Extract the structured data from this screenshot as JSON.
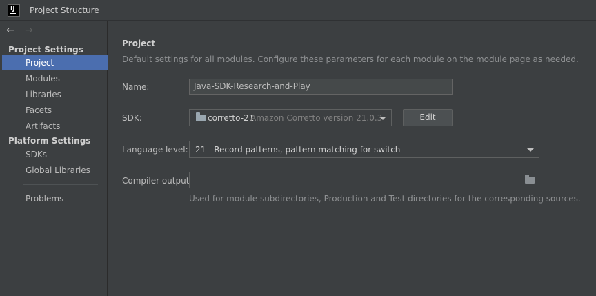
{
  "window": {
    "title": "Project Structure",
    "app_icon_text": "IJ"
  },
  "sidebar": {
    "section_project_settings": "Project Settings",
    "project_items": [
      {
        "label": "Project",
        "selected": true
      },
      {
        "label": "Modules"
      },
      {
        "label": "Libraries"
      },
      {
        "label": "Facets"
      },
      {
        "label": "Artifacts"
      }
    ],
    "section_platform_settings": "Platform Settings",
    "platform_items": [
      {
        "label": "SDKs"
      },
      {
        "label": "Global Libraries"
      }
    ],
    "problems": {
      "label": "Problems"
    }
  },
  "main": {
    "heading": "Project",
    "description": "Default settings for all modules. Configure these parameters for each module on the module page as needed.",
    "name": {
      "label": "Name:",
      "value": "Java-SDK-Research-and-Play"
    },
    "sdk": {
      "label": "SDK:",
      "name": "corretto-21",
      "version": "Amazon Corretto version 21.0.3",
      "edit_button": "Edit"
    },
    "language_level": {
      "label": "Language level:",
      "value": "21 - Record patterns, pattern matching for switch"
    },
    "compiler_output": {
      "label": "Compiler output:",
      "value": "",
      "hint": "Used for module subdirectories, Production and Test directories for the corresponding sources."
    }
  },
  "colors": {
    "background": "#3c3f41",
    "selection": "#4b6eaf",
    "text": "#bbbbbb",
    "muted_text": "#8f9193"
  }
}
